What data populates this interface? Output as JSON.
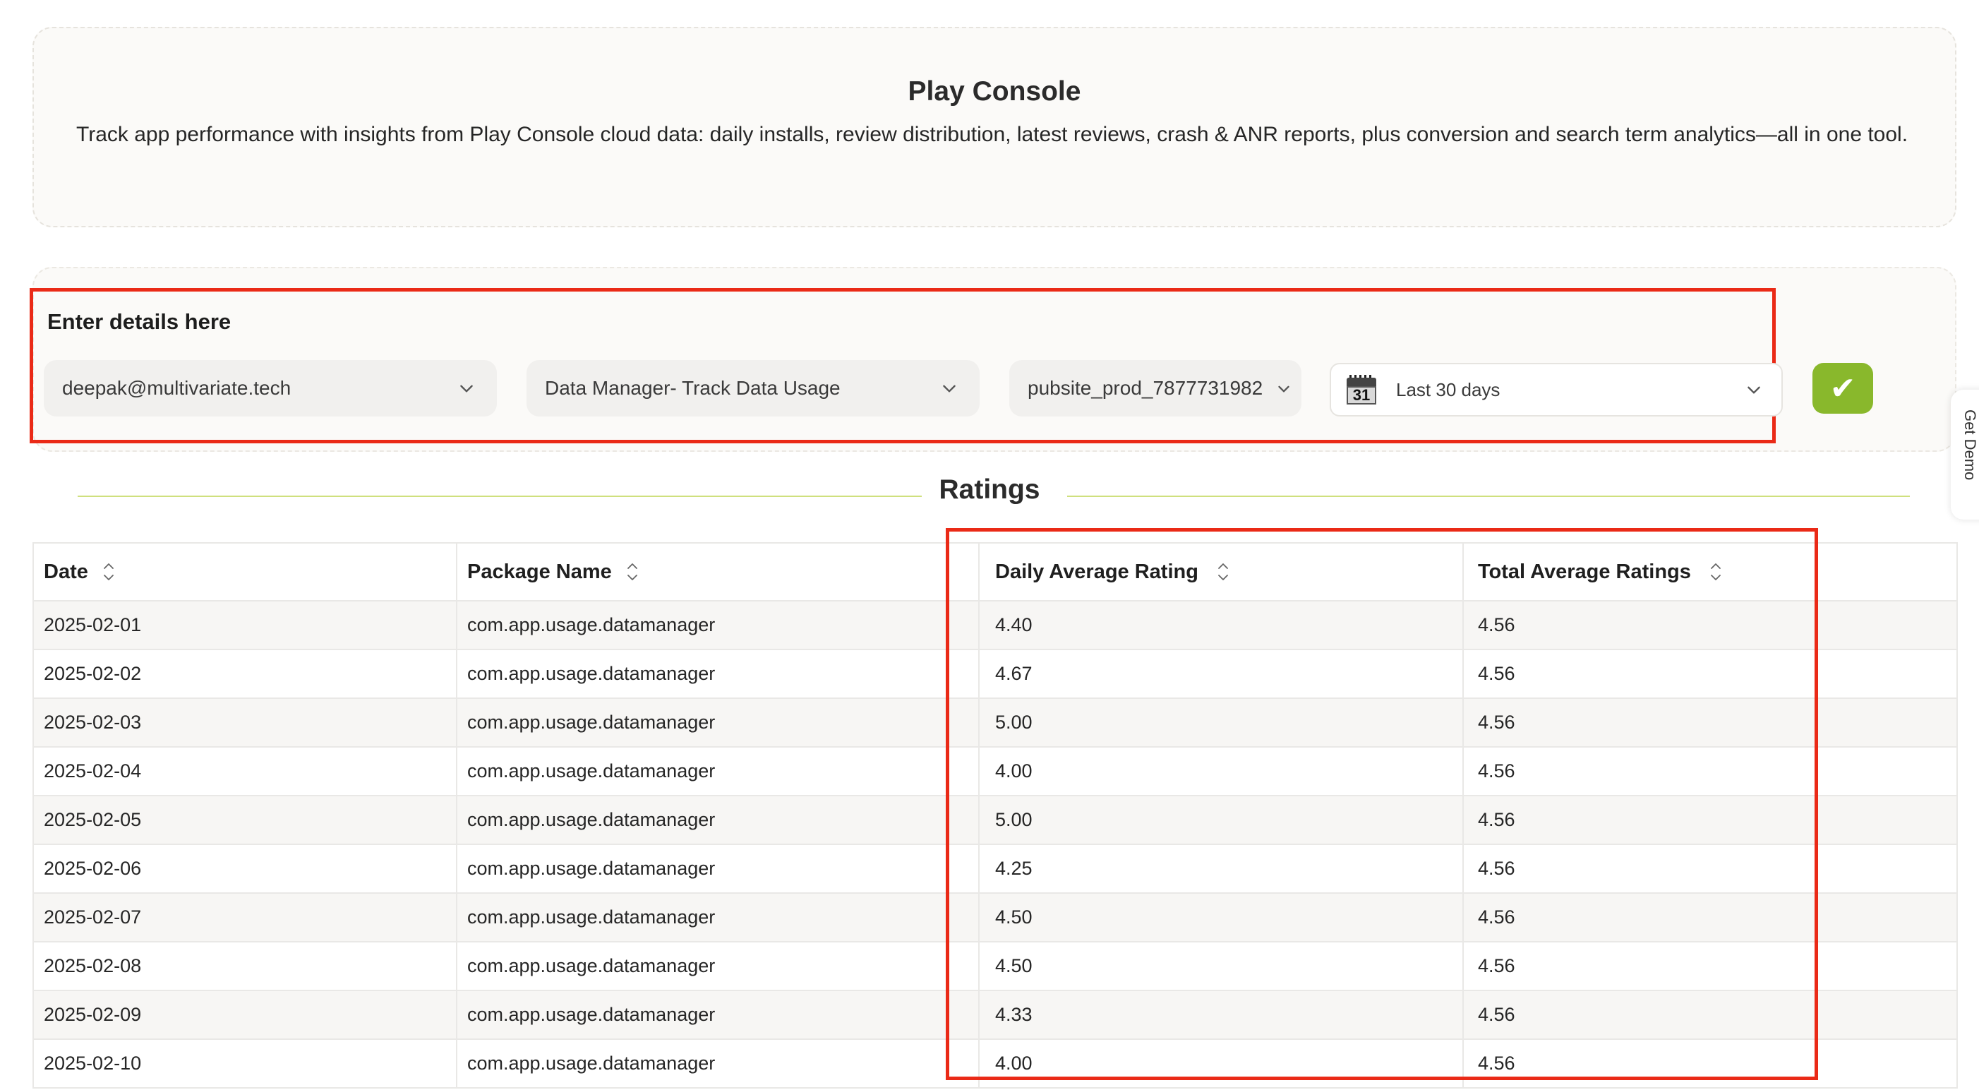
{
  "header": {
    "title": "Play Console",
    "description": "Track app performance with insights from Play Console cloud data: daily installs, review distribution, latest reviews, crash & ANR reports, plus conversion and search term analytics—all in one tool."
  },
  "form": {
    "label": "Enter details here",
    "account": "deepak@multivariate.tech",
    "app": "Data Manager- Track Data Usage",
    "project": "pubsite_prod_7877731982",
    "date_range": "Last 30 days",
    "calendar_day": "31",
    "submit_glyph": "✔"
  },
  "side_tab": {
    "label": "Get Demo"
  },
  "section": {
    "title": "Ratings"
  },
  "table": {
    "columns": [
      "Date",
      "Package Name",
      "Daily Average Rating",
      "Total Average Ratings"
    ],
    "rows": [
      [
        "2025-02-01",
        "com.app.usage.datamanager",
        "4.40",
        "4.56"
      ],
      [
        "2025-02-02",
        "com.app.usage.datamanager",
        "4.67",
        "4.56"
      ],
      [
        "2025-02-03",
        "com.app.usage.datamanager",
        "5.00",
        "4.56"
      ],
      [
        "2025-02-04",
        "com.app.usage.datamanager",
        "4.00",
        "4.56"
      ],
      [
        "2025-02-05",
        "com.app.usage.datamanager",
        "5.00",
        "4.56"
      ],
      [
        "2025-02-06",
        "com.app.usage.datamanager",
        "4.25",
        "4.56"
      ],
      [
        "2025-02-07",
        "com.app.usage.datamanager",
        "4.50",
        "4.56"
      ],
      [
        "2025-02-08",
        "com.app.usage.datamanager",
        "4.50",
        "4.56"
      ],
      [
        "2025-02-09",
        "com.app.usage.datamanager",
        "4.33",
        "4.56"
      ],
      [
        "2025-02-10",
        "com.app.usage.datamanager",
        "4.00",
        "4.56"
      ]
    ]
  },
  "colors": {
    "accent_green": "#89b82c",
    "highlight_red": "#ea2a17",
    "divider_green": "#cfe07e"
  },
  "icons": [
    "chevron-down-icon",
    "calendar-icon",
    "checkmark-icon",
    "sort-icon"
  ]
}
